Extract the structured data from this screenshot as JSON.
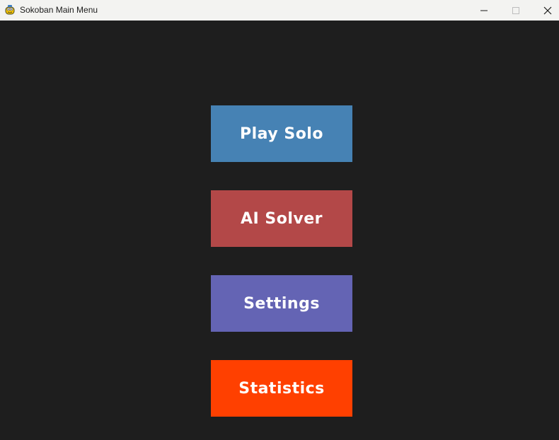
{
  "window": {
    "title": "Sokoban Main Menu",
    "app_icon": "pygame-snake-icon",
    "controls": {
      "minimize_icon": "minimize-icon",
      "maximize_icon": "maximize-icon",
      "close_icon": "close-icon"
    }
  },
  "menu": {
    "buttons": [
      {
        "label": "Play Solo",
        "color": "#4682b4"
      },
      {
        "label": "AI Solver",
        "color": "#b34848"
      },
      {
        "label": "Settings",
        "color": "#6464b4"
      },
      {
        "label": "Statistics",
        "color": "#ff4000"
      }
    ]
  },
  "colors": {
    "background": "#1e1e1e",
    "titlebar": "#f3f3f1",
    "button_text": "#ffffff"
  }
}
